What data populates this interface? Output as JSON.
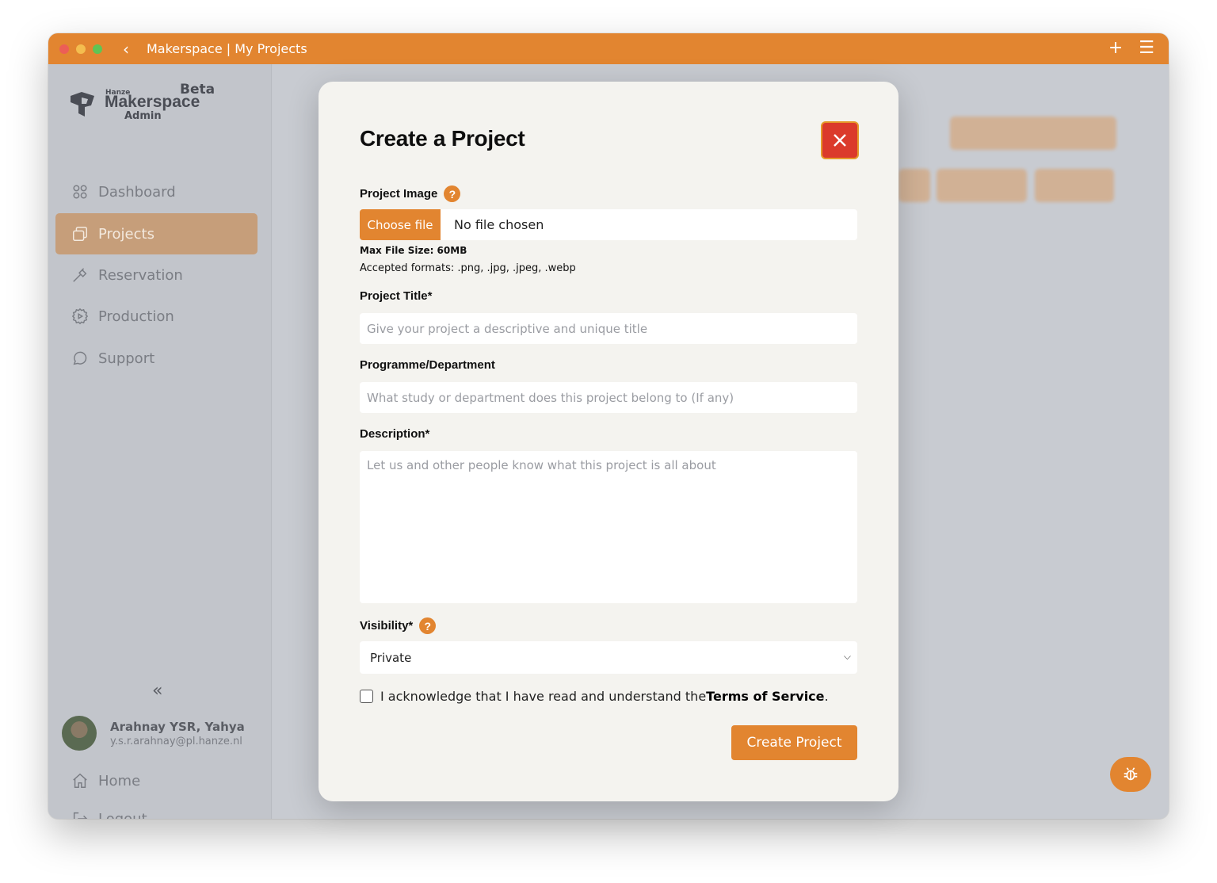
{
  "window": {
    "title": "Makerspace | My Projects",
    "back_icon": "chevron-left-icon",
    "new_icon": "plus-icon",
    "menu_icon": "hamburger-icon"
  },
  "brand": {
    "hanze": "Hanze",
    "beta": "Beta",
    "name": "Makerspace",
    "role": "Admin"
  },
  "sidebar": {
    "items": [
      {
        "label": "Dashboard",
        "icon": "grid-icon",
        "active": false
      },
      {
        "label": "Projects",
        "icon": "folders-icon",
        "active": true
      },
      {
        "label": "Reservation",
        "icon": "hammer-icon",
        "active": false
      },
      {
        "label": "Production",
        "icon": "gear-play-icon",
        "active": false
      },
      {
        "label": "Support",
        "icon": "chat-bubble-icon",
        "active": false
      }
    ],
    "collapse_glyph": "«",
    "user": {
      "name": "Arahnay YSR, Yahya",
      "email": "y.s.r.arahnay@pl.hanze.nl"
    },
    "bottom": [
      {
        "label": "Home",
        "icon": "home-icon"
      },
      {
        "label": "Logout",
        "icon": "logout-icon"
      }
    ]
  },
  "modal": {
    "title": "Create a Project",
    "image_label": "Project Image",
    "help_glyph": "?",
    "choose_file": "Choose file",
    "no_file": "No file chosen",
    "max_size": "Max File Size: 60MB",
    "formats": "Accepted formats: .png, .jpg, .jpeg, .webp",
    "title_label": "Project Title*",
    "title_placeholder": "Give your project a descriptive and unique title",
    "programme_label": "Programme/Department",
    "programme_placeholder": "What study or department does this project belong to (If any)",
    "description_label": "Description*",
    "description_placeholder": "Let us and other people know what this project is all about",
    "visibility_label": "Visibility*",
    "visibility_value": "Private",
    "ack_text": "I acknowledge that I have read and understand the ",
    "ack_link": "Terms of Service",
    "ack_end": ".",
    "submit": "Create Project"
  },
  "colors": {
    "accent": "#e28530",
    "close": "#db3a2b"
  }
}
